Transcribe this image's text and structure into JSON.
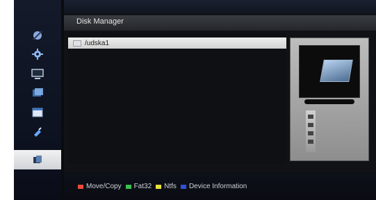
{
  "header": {
    "title": "Disk Manager"
  },
  "sidebar": {
    "items": [
      {
        "icon": "satellite-icon",
        "active": false
      },
      {
        "icon": "gear-icon",
        "active": false
      },
      {
        "icon": "display-icon",
        "active": false
      },
      {
        "icon": "media-icon",
        "active": false
      },
      {
        "icon": "window-icon",
        "active": false
      },
      {
        "icon": "tools-icon",
        "active": false
      },
      {
        "icon": "disk-manager-icon",
        "active": true
      }
    ]
  },
  "list": {
    "items": [
      {
        "label": "/udska1",
        "icon": "folder-icon",
        "selected": true
      }
    ]
  },
  "preview": {
    "thumbnail_icon": "hard-disk-icon",
    "actions": [
      {
        "icon": "format-icon"
      },
      {
        "icon": "eject-icon"
      },
      {
        "icon": "info-icon"
      },
      {
        "icon": "refresh-icon"
      }
    ]
  },
  "footer": {
    "legend": [
      {
        "key": "red",
        "color": "#e94b3b",
        "label": "Move/Copy"
      },
      {
        "key": "green",
        "color": "#37c14c",
        "label": "Fat32"
      },
      {
        "key": "yellow",
        "color": "#e8e13a",
        "label": "Ntfs"
      },
      {
        "key": "blue",
        "color": "#2f4fd9",
        "label": "Device Information"
      }
    ]
  },
  "colors": {
    "accent": "#e6e6e6",
    "background": "#0b0c0f"
  }
}
